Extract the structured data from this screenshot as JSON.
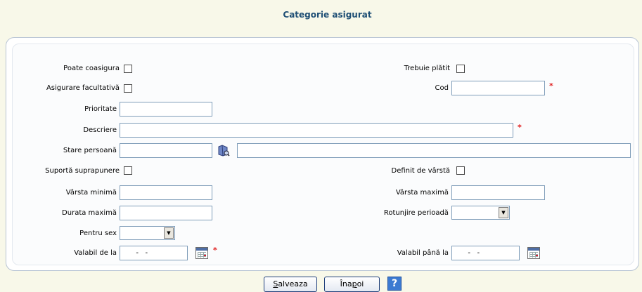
{
  "page": {
    "title": "Categorie asigurat"
  },
  "form": {
    "poate_coasigura": {
      "label": "Poate coasigura",
      "checked": false
    },
    "trebuie_platit": {
      "label": "Trebuie plătit",
      "checked": false
    },
    "asigurare_facultativa": {
      "label": "Asigurare facultativă",
      "checked": false
    },
    "cod": {
      "label": "Cod",
      "value": "",
      "required_mark": "*"
    },
    "prioritate": {
      "label": "Prioritate",
      "value": ""
    },
    "descriere": {
      "label": "Descriere",
      "value": "",
      "required_mark": "*"
    },
    "stare_persoana": {
      "label": "Stare persoană",
      "code_value": "",
      "name_value": "",
      "lookup_icon": "folder-lookup-icon"
    },
    "suporta_suprapunere": {
      "label": "Suportă suprapunere",
      "checked": false
    },
    "definit_de_varsta": {
      "label": "Definit de vârstă",
      "checked": false
    },
    "varsta_minima": {
      "label": "Vârsta minimă",
      "value": ""
    },
    "varsta_maxima": {
      "label": "Vârsta maximă",
      "value": ""
    },
    "durata_maxima": {
      "label": "Durata maximă",
      "value": ""
    },
    "rotunjire_perioada": {
      "label": "Rotunjire perioadă",
      "selected": ""
    },
    "pentru_sex": {
      "label": "Pentru sex",
      "selected": ""
    },
    "valabil_de_la": {
      "label": "Valabil de la",
      "value": "  -   -",
      "required_mark": "*",
      "icon": "calendar-icon"
    },
    "valabil_pana_la": {
      "label": "Valabil până la",
      "value": "  -   -",
      "icon": "calendar-icon"
    }
  },
  "buttons": {
    "save": {
      "mnemonic": "S",
      "rest": "alveaza"
    },
    "back": {
      "prefix": "Îna",
      "mnemonic": "p",
      "suffix": "oi"
    },
    "help": {
      "label": "?",
      "icon": "help-icon"
    }
  },
  "colors": {
    "background": "#f8f8e9",
    "title": "#1f4f75",
    "panel_border": "#b8c4d4",
    "input_border": "#7f9db9",
    "required": "#e02020",
    "help_button": "#3c7ad1"
  }
}
